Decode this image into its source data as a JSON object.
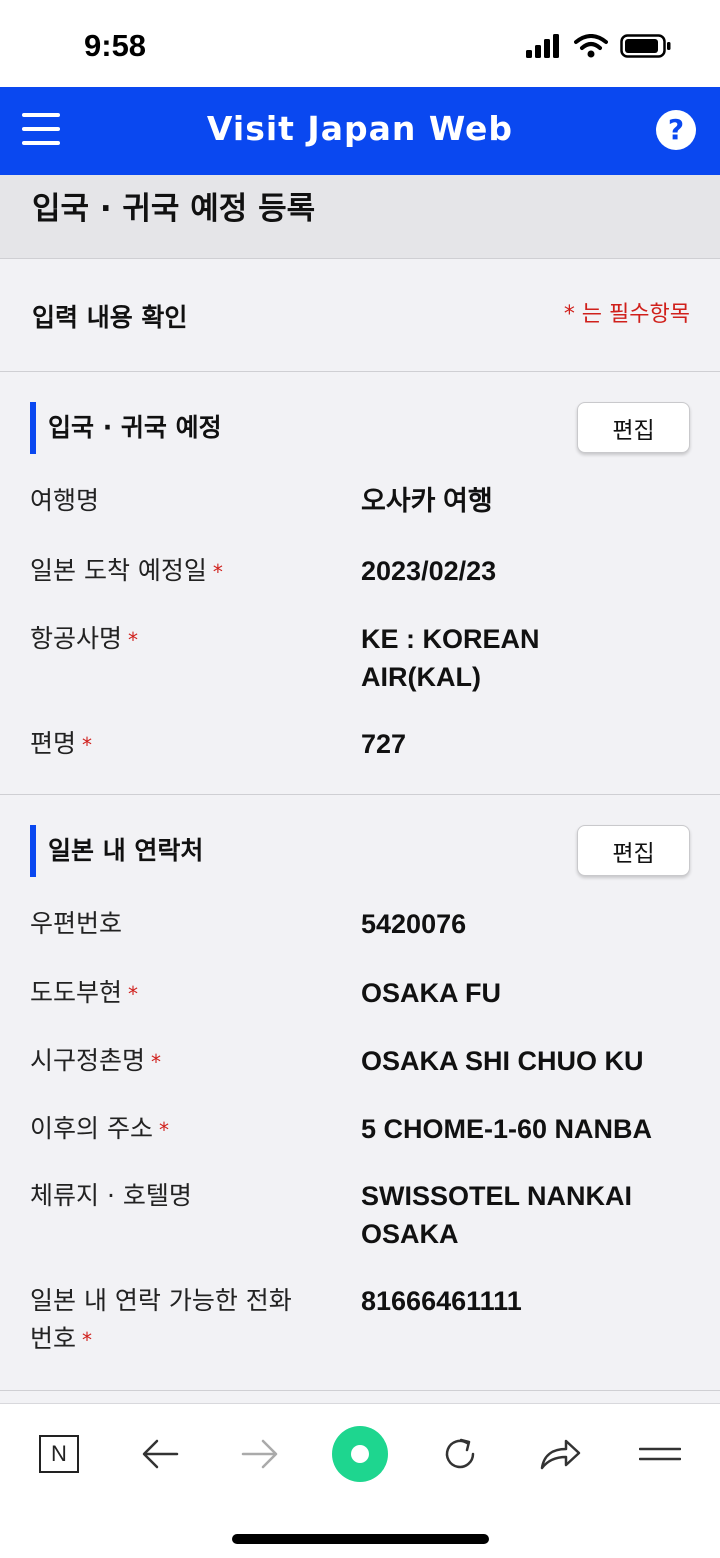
{
  "status_bar": {
    "time": "9:58"
  },
  "header": {
    "title": "Visit Japan Web"
  },
  "page": {
    "heading": "입국 · 귀국 예정 등록"
  },
  "confirm": {
    "label": "입력 내용 확인",
    "required_note": "* 는 필수항목"
  },
  "sections": [
    {
      "title": "입국 · 귀국 예정",
      "edit_label": "편집",
      "fields": [
        {
          "label": "여행명",
          "required": false,
          "value": "오사카 여행"
        },
        {
          "label": "일본 도착 예정일",
          "required": true,
          "value": "2023/02/23"
        },
        {
          "label": "항공사명",
          "required": true,
          "value_line1": "KE : KOREAN",
          "value_line2": "AIR(KAL)"
        },
        {
          "label": "편명",
          "required": true,
          "value": "727"
        }
      ]
    },
    {
      "title": "일본 내 연락처",
      "edit_label": "편집",
      "fields": [
        {
          "label": "우편번호",
          "required": false,
          "value": "5420076"
        },
        {
          "label": "도도부현",
          "required": true,
          "value": "OSAKA FU"
        },
        {
          "label": "시구정촌명",
          "required": true,
          "value": "OSAKA SHI CHUO KU"
        },
        {
          "label": "이후의 주소",
          "required": true,
          "value": "5 CHOME-1-60 NANBA"
        },
        {
          "label": "체류지 · 호텔명",
          "required": false,
          "value_line1": "SWISSOTEL NANKAI",
          "value_line2": "OSAKA"
        },
        {
          "label_line1": "일본 내 연락 가능한 전화",
          "label_line2": "번호",
          "required": true,
          "value": "81666461111"
        }
      ]
    }
  ],
  "required_mark": "*",
  "browser_toolbar": {
    "icons": [
      "naver-n-icon",
      "back-arrow-icon",
      "forward-arrow-icon",
      "green-circle-icon",
      "refresh-icon",
      "share-icon",
      "menu-lines-icon"
    ],
    "n_label": "N"
  },
  "colors": {
    "brand_blue": "#0a48f0",
    "required_red": "#d0201b",
    "green_accent": "#1ed68f"
  }
}
